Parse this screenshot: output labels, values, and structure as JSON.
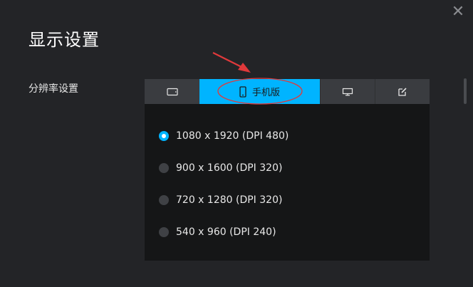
{
  "dialog": {
    "title": "显示设置",
    "close_icon": "close-icon"
  },
  "resolution": {
    "label": "分辨率设置",
    "tabs": [
      {
        "icon": "tablet-landscape-icon",
        "label": "",
        "active": false
      },
      {
        "icon": "phone-icon",
        "label": "手机版",
        "active": true
      },
      {
        "icon": "monitor-icon",
        "label": "",
        "active": false
      },
      {
        "icon": "edit-icon",
        "label": "",
        "active": false
      }
    ],
    "options": [
      {
        "label": "1080 x 1920 (DPI 480)",
        "checked": true
      },
      {
        "label": "900 x 1600 (DPI 320)",
        "checked": false
      },
      {
        "label": "720 x 1280 (DPI 320)",
        "checked": false
      },
      {
        "label": "540 x 960 (DPI 240)",
        "checked": false
      }
    ]
  },
  "colors": {
    "accent": "#00b4ff",
    "background": "#232427",
    "panel": "#151617",
    "annotation": "#e0393b"
  }
}
